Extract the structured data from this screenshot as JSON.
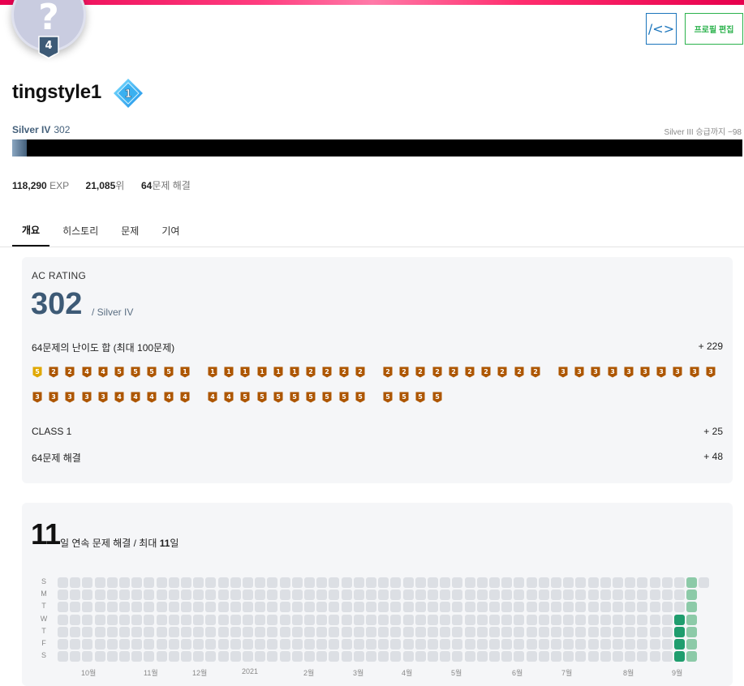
{
  "header": {
    "avatar_glyph": "?",
    "avatar_level": "4",
    "code_button_glyph": "/<>",
    "edit_profile_label": "프로필 편집",
    "accent_color": "#e8004f"
  },
  "profile": {
    "username": "tingstyle1",
    "class_badge": "1",
    "tier": "Silver IV",
    "rating": "302",
    "next_tier_text": "Silver III 승급까지 −98",
    "progress_fraction": 0.02,
    "tier_color": "#435f7a"
  },
  "stats": {
    "exp_value": "118,290",
    "exp_unit": "EXP",
    "rank_value": "21,085",
    "rank_unit": "위",
    "solved_value": "64",
    "solved_unit": "문제 해결"
  },
  "tabs": [
    {
      "label": "개요",
      "active": true
    },
    {
      "label": "히스토리",
      "active": false
    },
    {
      "label": "문제",
      "active": false
    },
    {
      "label": "기여",
      "active": false
    }
  ],
  "ac_rating": {
    "title": "AC RATING",
    "value": "302",
    "tier_suffix": "/ Silver IV",
    "difficulty_label": "64문제의 난이도 합 (최대 100문제)",
    "difficulty_value": "+ 229",
    "class_label": "CLASS 1",
    "class_value": "+ 25",
    "solved_label": "64문제 해결",
    "solved_value": "+ 48",
    "tier_rows": [
      [
        {
          "level": "5",
          "tier": "silver"
        },
        {
          "level": "2",
          "tier": "bronze"
        },
        {
          "level": "2",
          "tier": "bronze"
        },
        {
          "level": "4",
          "tier": "bronze"
        },
        {
          "level": "4",
          "tier": "bronze"
        },
        {
          "level": "5",
          "tier": "bronze"
        },
        {
          "level": "5",
          "tier": "bronze"
        },
        {
          "level": "5",
          "tier": "bronze"
        },
        {
          "level": "5",
          "tier": "bronze"
        },
        {
          "level": "1",
          "tier": "bronze"
        },
        {
          "level": "1",
          "tier": "bronze"
        },
        {
          "level": "1",
          "tier": "bronze"
        },
        {
          "level": "1",
          "tier": "bronze"
        },
        {
          "level": "1",
          "tier": "bronze"
        },
        {
          "level": "1",
          "tier": "bronze"
        },
        {
          "level": "1",
          "tier": "bronze"
        },
        {
          "level": "2",
          "tier": "bronze"
        },
        {
          "level": "2",
          "tier": "bronze"
        },
        {
          "level": "2",
          "tier": "bronze"
        },
        {
          "level": "2",
          "tier": "bronze"
        },
        {
          "level": "2",
          "tier": "bronze"
        },
        {
          "level": "2",
          "tier": "bronze"
        },
        {
          "level": "2",
          "tier": "bronze"
        },
        {
          "level": "2",
          "tier": "bronze"
        },
        {
          "level": "2",
          "tier": "bronze"
        },
        {
          "level": "2",
          "tier": "bronze"
        },
        {
          "level": "2",
          "tier": "bronze"
        },
        {
          "level": "2",
          "tier": "bronze"
        },
        {
          "level": "2",
          "tier": "bronze"
        },
        {
          "level": "2",
          "tier": "bronze"
        },
        {
          "level": "3",
          "tier": "bronze"
        },
        {
          "level": "3",
          "tier": "bronze"
        },
        {
          "level": "3",
          "tier": "bronze"
        },
        {
          "level": "3",
          "tier": "bronze"
        },
        {
          "level": "3",
          "tier": "bronze"
        },
        {
          "level": "3",
          "tier": "bronze"
        },
        {
          "level": "3",
          "tier": "bronze"
        },
        {
          "level": "3",
          "tier": "bronze"
        },
        {
          "level": "3",
          "tier": "bronze"
        },
        {
          "level": "3",
          "tier": "bronze"
        }
      ],
      [
        {
          "level": "3",
          "tier": "bronze"
        },
        {
          "level": "3",
          "tier": "bronze"
        },
        {
          "level": "3",
          "tier": "bronze"
        },
        {
          "level": "3",
          "tier": "bronze"
        },
        {
          "level": "3",
          "tier": "bronze"
        },
        {
          "level": "4",
          "tier": "bronze"
        },
        {
          "level": "4",
          "tier": "bronze"
        },
        {
          "level": "4",
          "tier": "bronze"
        },
        {
          "level": "4",
          "tier": "bronze"
        },
        {
          "level": "4",
          "tier": "bronze"
        },
        {
          "level": "4",
          "tier": "bronze"
        },
        {
          "level": "4",
          "tier": "bronze"
        },
        {
          "level": "5",
          "tier": "bronze"
        },
        {
          "level": "5",
          "tier": "bronze"
        },
        {
          "level": "5",
          "tier": "bronze"
        },
        {
          "level": "5",
          "tier": "bronze"
        },
        {
          "level": "5",
          "tier": "bronze"
        },
        {
          "level": "5",
          "tier": "bronze"
        },
        {
          "level": "5",
          "tier": "bronze"
        },
        {
          "level": "5",
          "tier": "bronze"
        },
        {
          "level": "5",
          "tier": "bronze"
        },
        {
          "level": "5",
          "tier": "bronze"
        },
        {
          "level": "5",
          "tier": "bronze"
        },
        {
          "level": "5",
          "tier": "bronze"
        }
      ]
    ],
    "tier_colors": {
      "silver_base": "#3d5a76",
      "bronze_base": "#ad5600",
      "silver_top_first": "#e0a800"
    }
  },
  "streak": {
    "current": "11",
    "text_before": "일 연속 문제 해결 / 최대 ",
    "max": "11",
    "text_after": "일",
    "day_labels": [
      "S",
      "M",
      "T",
      "W",
      "T",
      "F",
      "S"
    ],
    "month_labels": [
      "10월",
      "11월",
      "12월",
      "2021",
      "2월",
      "3월",
      "4월",
      "5월",
      "6월",
      "7월",
      "8월",
      "9월"
    ],
    "colors": {
      "empty": "#dcdfe4",
      "light": "#8ccaa8",
      "dark": "#1f9d6e"
    },
    "active_cells": [
      {
        "week": 51,
        "day": 0,
        "level": "light"
      },
      {
        "week": 51,
        "day": 1,
        "level": "light"
      },
      {
        "week": 51,
        "day": 2,
        "level": "light"
      },
      {
        "week": 50,
        "day": 3,
        "level": "dark"
      },
      {
        "week": 51,
        "day": 3,
        "level": "light"
      },
      {
        "week": 50,
        "day": 4,
        "level": "dark"
      },
      {
        "week": 51,
        "day": 4,
        "level": "light"
      },
      {
        "week": 50,
        "day": 5,
        "level": "dark"
      },
      {
        "week": 51,
        "day": 5,
        "level": "light"
      },
      {
        "week": 50,
        "day": 6,
        "level": "dark"
      },
      {
        "week": 51,
        "day": 6,
        "level": "light"
      }
    ],
    "weeks": 53,
    "last_week_days": 1
  }
}
